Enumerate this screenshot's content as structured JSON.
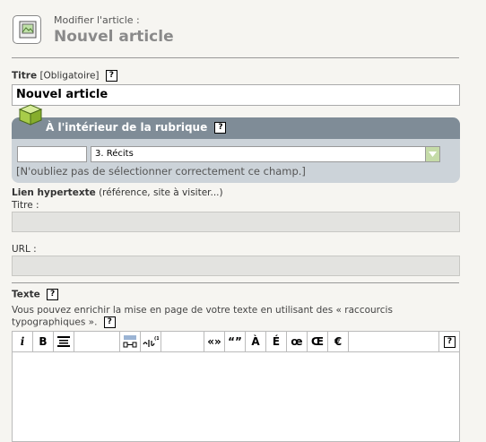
{
  "header": {
    "subtitle": "Modifier l'article :",
    "title": "Nouvel article"
  },
  "titre": {
    "label": "Titre",
    "note": "[Obligatoire]",
    "value": "Nouvel article"
  },
  "rubrique": {
    "heading": "À l'intérieur de la rubrique",
    "selected": "3. Récits",
    "note": "[N'oubliez pas de sélectionner correctement ce champ.]"
  },
  "lien": {
    "label": "Lien hypertexte",
    "note": "(référence, site à visiter...)",
    "titre_label": "Titre :",
    "url_label": "URL :"
  },
  "texte": {
    "label": "Texte",
    "help_line1": "Vous pouvez enrichir la mise en page de votre texte en utilisant des « raccourcis",
    "help_line2": "typographiques ».",
    "toolbar": {
      "italic": "i",
      "bold": "B",
      "chevrons": "«»",
      "quotes": "“”",
      "a_grave": "À",
      "e_acute": "É",
      "oe": "œ",
      "OE": "Œ",
      "euro": "€",
      "help": "?"
    }
  },
  "help_glyph": "?"
}
